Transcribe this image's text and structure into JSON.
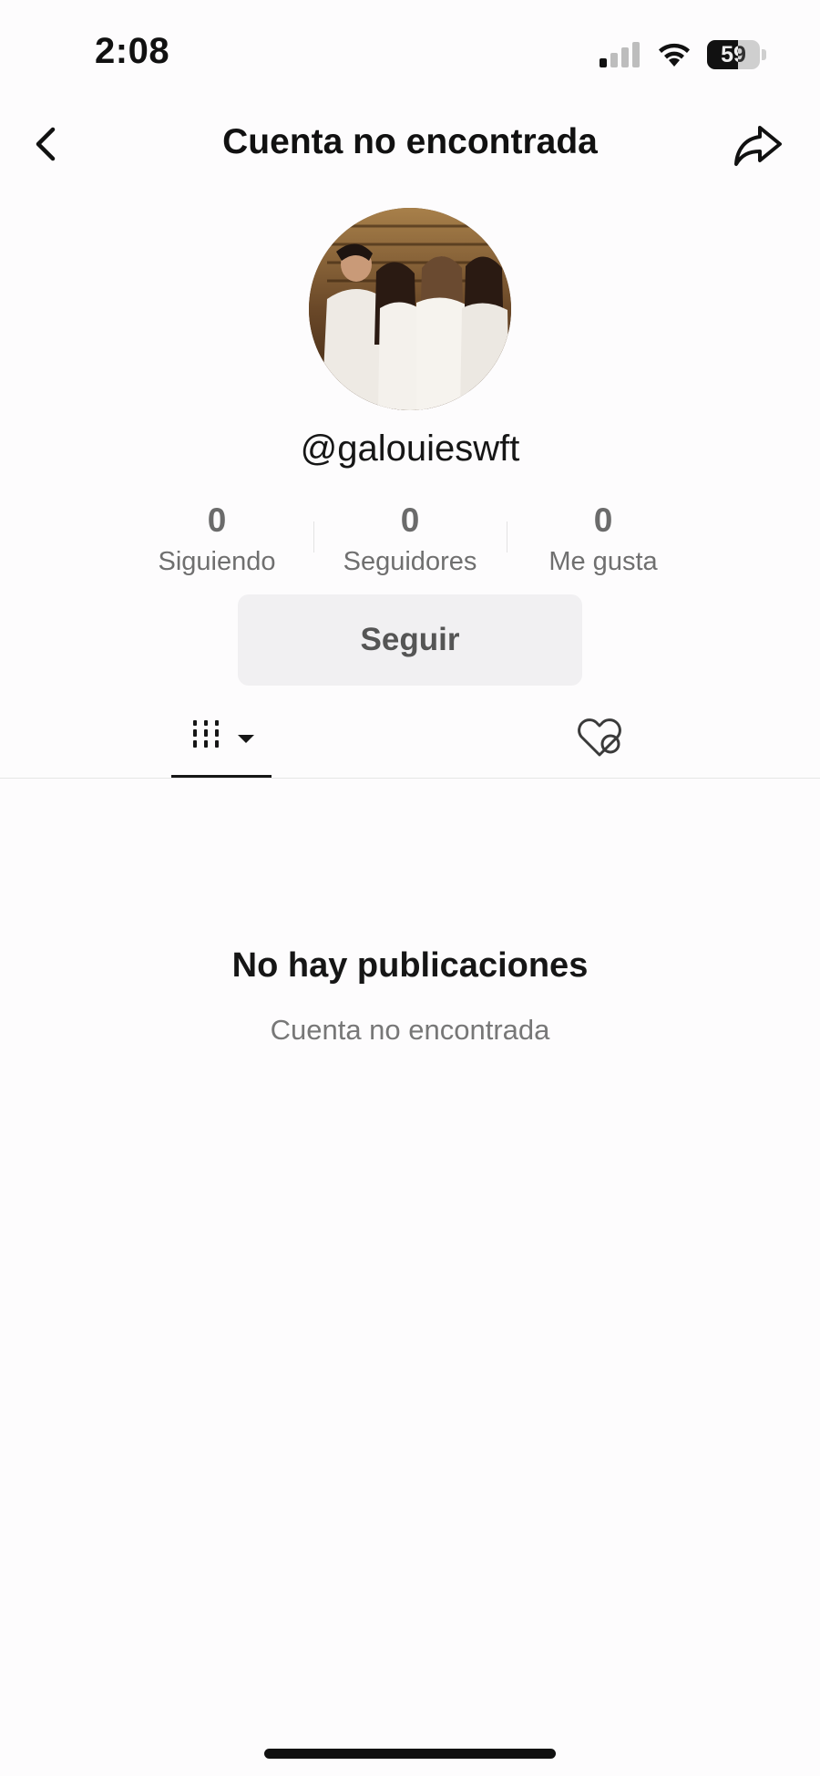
{
  "status_bar": {
    "time": "2:08",
    "battery_level": "59",
    "battery_fraction": 0.59
  },
  "nav": {
    "title": "Cuenta no encontrada",
    "back_icon": "chevron-left-icon",
    "share_icon": "share-arrow-icon"
  },
  "profile": {
    "username": "@galouieswft",
    "avatar": "group-photo-avatar",
    "stats": [
      {
        "value": "0",
        "label": "Siguiendo"
      },
      {
        "value": "0",
        "label": "Seguidores"
      },
      {
        "value": "0",
        "label": "Me gusta"
      }
    ],
    "follow_label": "Seguir"
  },
  "tabs": [
    {
      "icon": "grid-icon",
      "active": true,
      "dropdown": "caret-down-icon"
    },
    {
      "icon": "liked-hidden-icon",
      "active": false
    }
  ],
  "empty_state": {
    "title": "No hay publicaciones",
    "subtitle": "Cuenta no encontrada"
  },
  "colors": {
    "background": "#fdfcfd",
    "text": "#161616",
    "muted": "#6f6f6f",
    "button_bg": "#f1f0f2"
  }
}
